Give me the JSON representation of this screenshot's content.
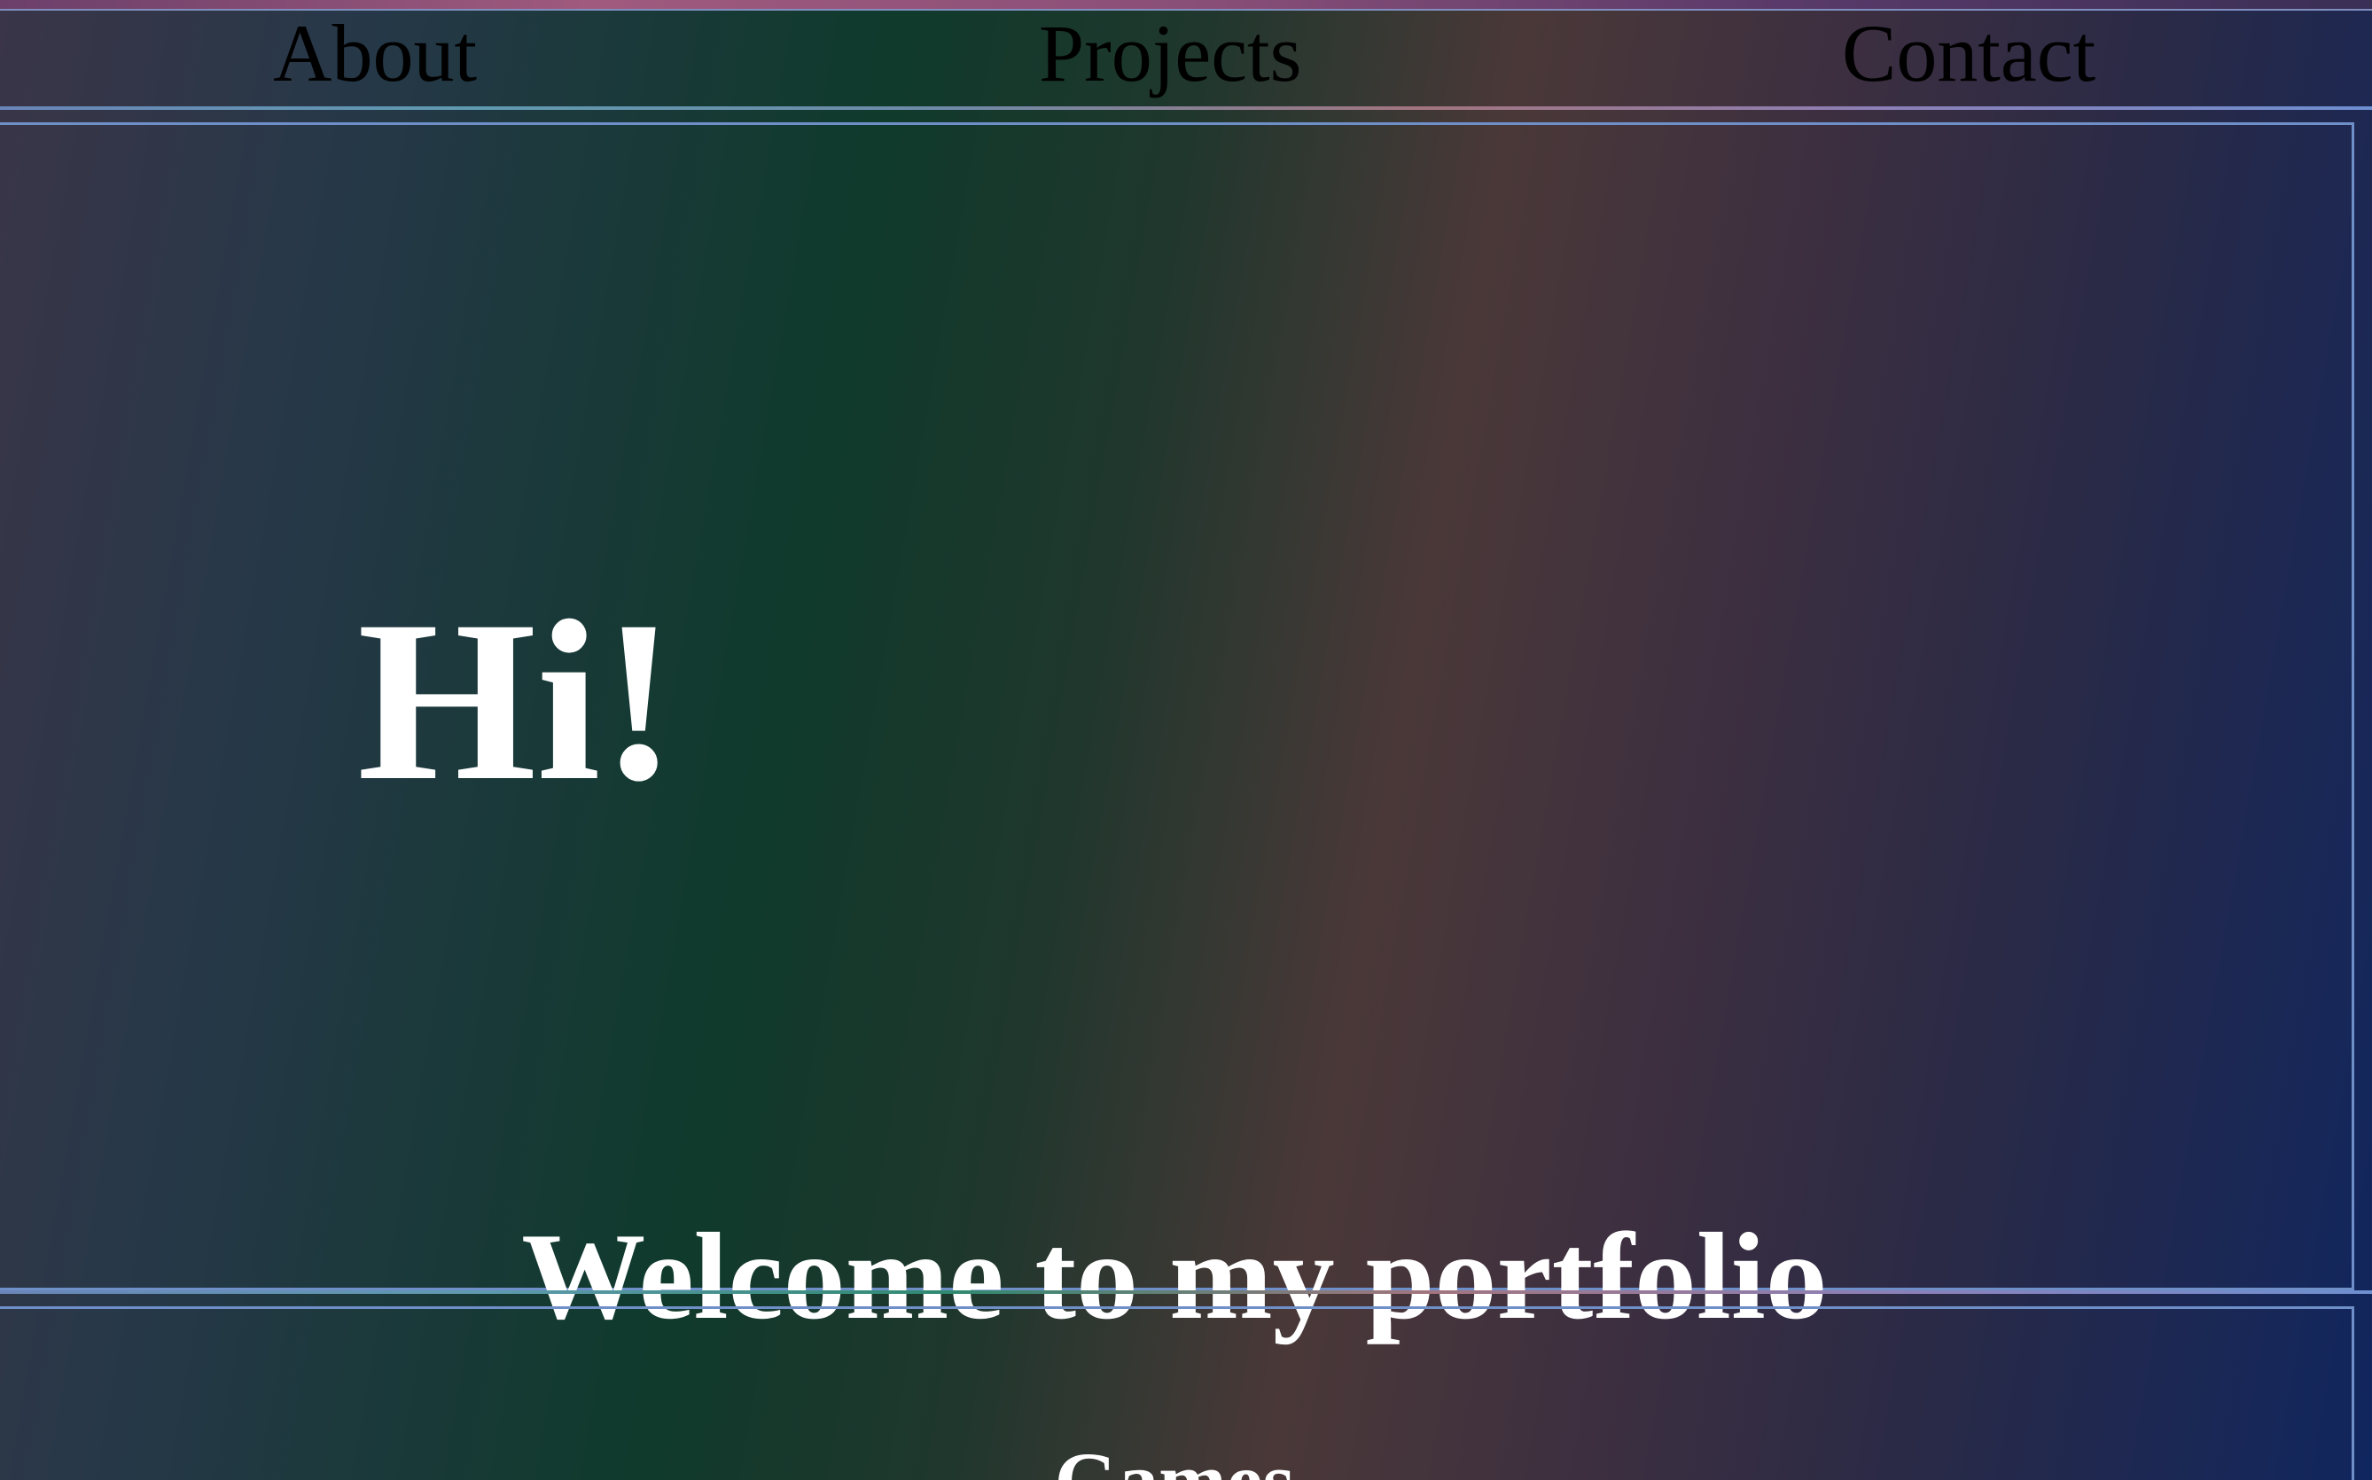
{
  "nav": {
    "about_label": "About",
    "projects_label": "Projects",
    "contact_label": "Contact"
  },
  "hero": {
    "greeting": "Hi!",
    "welcome": "Welcome to my portfolio"
  },
  "sections": {
    "games_title": "Games"
  },
  "colors": {
    "text_primary": "#ffffff",
    "nav_text": "#000000",
    "border": "#6f8fc8"
  }
}
